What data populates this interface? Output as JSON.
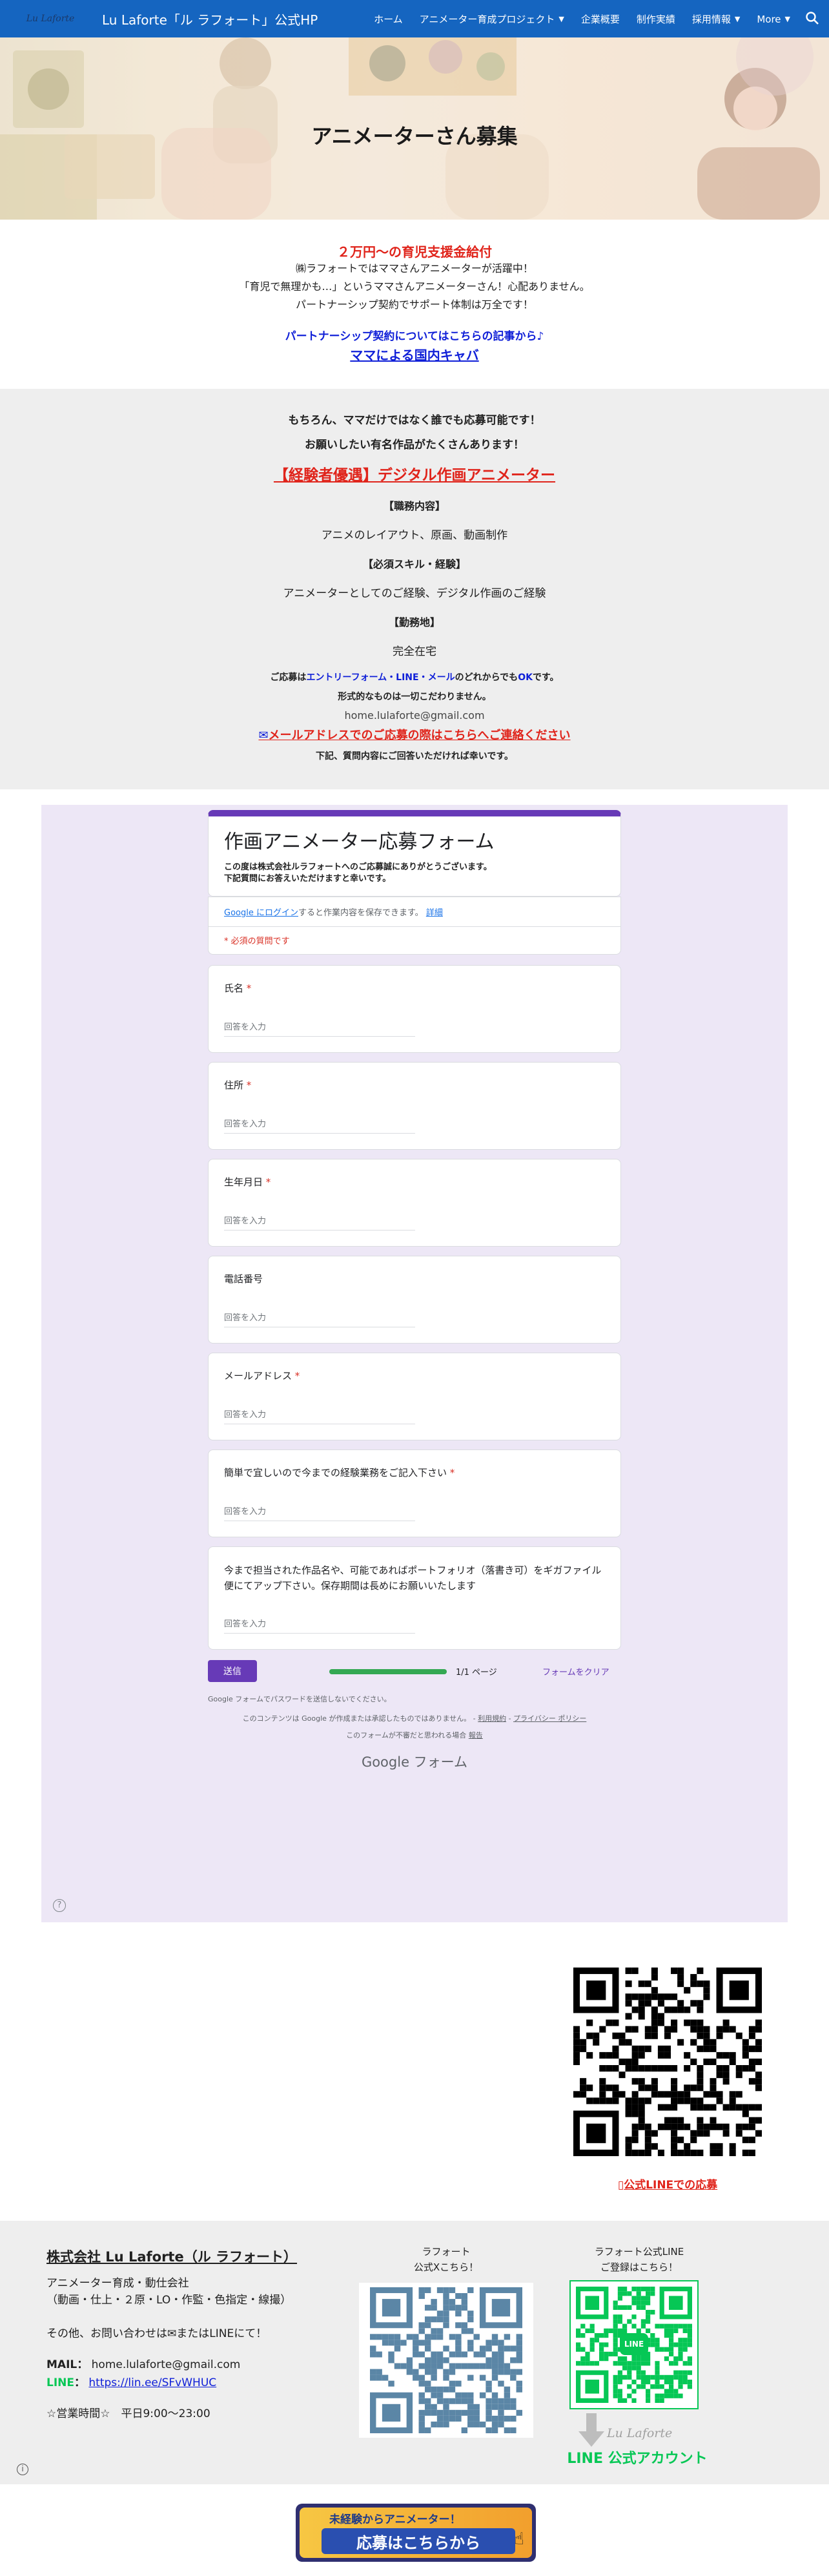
{
  "header": {
    "logo_text": "Lu Laforte",
    "site_title": "Lu Laforte「ル ラフォート」公式HP",
    "nav": [
      {
        "label": "ホーム",
        "has_menu": false
      },
      {
        "label": "アニメーター育成プロジェクト",
        "has_menu": true
      },
      {
        "label": "企業概要",
        "has_menu": false
      },
      {
        "label": "制作実績",
        "has_menu": false
      },
      {
        "label": "採用情報",
        "has_menu": true
      },
      {
        "label": "More",
        "has_menu": true
      }
    ],
    "search_icon": "search-icon",
    "bar_color": "#1565c0"
  },
  "hero": {
    "title": "アニメーターさん募集"
  },
  "support": {
    "headline": "２万円〜の育児支援金給付",
    "lines": [
      "㈱ラフォートではママさんアニメーターが活躍中！",
      "「育児で無理かも…」というママさんアニメーターさん！心配ありません。",
      "パートナーシップ契約でサポート体制は万全です！"
    ],
    "link_intro": "パートナーシップ契約についてはこちらの記事から♪",
    "link_text": "ママによる国内キャバ"
  },
  "job": {
    "intro1": "もちろん、ママだけではなく誰でも応募可能です！",
    "intro2": "お願いしたい有名作品がたくさんあります！",
    "title": "【経験者優遇】デジタル作画アニメーター",
    "duty_h": "【職務内容】",
    "duty": "アニメのレイアウト、原画、動画制作",
    "skill_h": "【必須スキル・経験】",
    "skill": "アニメーターとしてのご経験、デジタル作画のご経験",
    "place_h": "【勤務地】",
    "place": "完全在宅",
    "apply_pre": "ご応募は",
    "apply_mid": "エントリーフォーム・LINE・メール",
    "apply_post": "のどれからでも",
    "apply_ok": "OK",
    "apply_end": "です。",
    "format": "形式的なものは一切こだわりません。",
    "email": "home.lulaforte@gmail.com",
    "email_note": "メールアドレスでのご応募の際はこちらへご連絡ください",
    "closing": "下記、質問内容にご回答いただければ幸いです。"
  },
  "form": {
    "title": "作画アニメーター応募フォーム",
    "desc1": "この度は株式会社ルラフォートへのご応募誠にありがとうございます。",
    "desc2": "下記質問にお答えいただけますと幸いです。",
    "login_link": "Google にログイン",
    "login_rest": "すると作業内容を保存できます。",
    "login_more": "詳細",
    "required_note": "* 必須の質問です",
    "placeholder": "回答を入力",
    "required_mark": " *",
    "fields": [
      {
        "label": "氏名",
        "required": true
      },
      {
        "label": "住所",
        "required": true
      },
      {
        "label": "生年月日",
        "required": true
      },
      {
        "label": "電話番号",
        "required": false
      },
      {
        "label": "メールアドレス",
        "required": true
      },
      {
        "label": "簡単で宜しいので今までの経験業務をご記入下さい",
        "required": true
      }
    ],
    "portfolio_label": "今まで担当された作品名や、可能であればポートフォリオ（落書き可）をギガファイル便にてアップ下さい。保存期間は長めにお願いいたします",
    "submit": "送信",
    "page": "1/1 ページ",
    "progress": 1.0,
    "clear": "フォームをクリア",
    "password_note": "Google フォームでパスワードを送信しないでください。",
    "disclaimer": "このコンテンツは Google が作成または承認したものではありません。 - ",
    "terms": "利用規約",
    "dash": " - ",
    "privacy": "プライバシー ポリシー",
    "abuse_pre": "このフォームが不審だと思われる場合 ",
    "abuse": "報告",
    "brand": "Google フォーム",
    "accent": "#673ab7"
  },
  "line_qr": {
    "caption": "公式LINEでの応募"
  },
  "footer": {
    "company": "株式会社 Lu Laforte（ル ラフォート）",
    "desc1": "アニメーター育成・動仕会社",
    "desc2": "（動画・仕上・２原・LO・作監・色指定・線撮）",
    "contact_pre": "その他、お問い合わせは",
    "contact_post": "またはLINEにて！",
    "mail_label": "MAIL",
    "mail": "home.lulaforte@gmail.com",
    "line_label": "LINE",
    "line_url": "https://lin.ee/SFvWHUC",
    "hours_label": "☆営業時間☆",
    "hours": "平日9:00〜23:00",
    "x_caption1": "ラフォート",
    "x_caption2": "公式Xこちら！",
    "line_caption1": "ラフォート公式LINE",
    "line_caption2": "ご登録はこちら！",
    "line_badge": "LINE",
    "line_brand": "Lu Laforte",
    "line_official": "LINE 公式アカウント"
  },
  "banner": {
    "line1": "未経験からアニメーター！",
    "line2": "応募はこちらから"
  }
}
